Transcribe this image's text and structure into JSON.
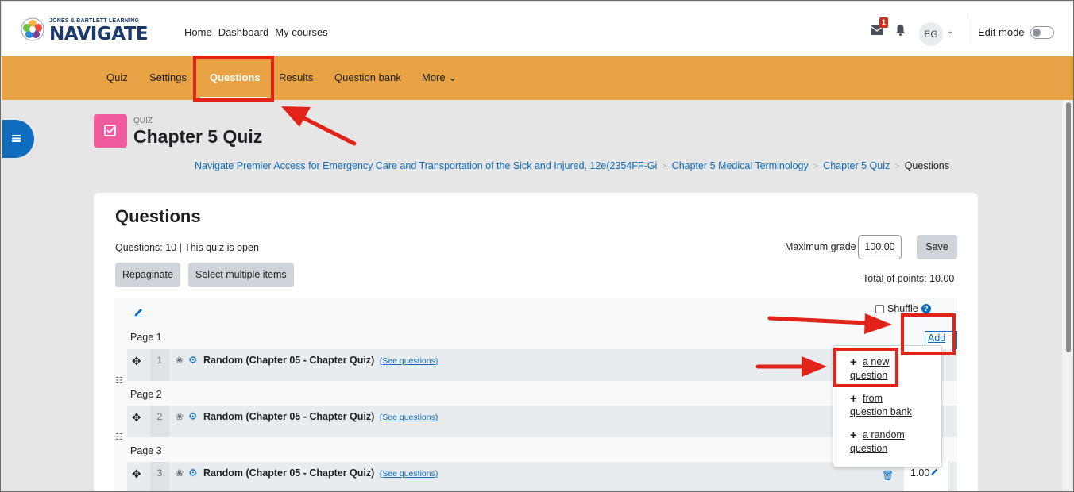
{
  "brand": {
    "sub": "JONES & BARTLETT LEARNING",
    "name": "NAVIGATE"
  },
  "topnav": [
    "Home",
    "Dashboard",
    "My courses"
  ],
  "notifications": {
    "message_count": "1",
    "user_initials": "EG",
    "edit_mode_label": "Edit mode"
  },
  "secnav": {
    "quiz": "Quiz",
    "settings": "Settings",
    "questions": "Questions",
    "results": "Results",
    "question_bank": "Question bank",
    "more": "More"
  },
  "header": {
    "type_label": "QUIZ",
    "title": "Chapter 5 Quiz",
    "breadcrumb": [
      "Navigate Premier Access for Emergency Care and Transportation of the Sick and Injured, 12e(2354FF-Gi",
      "Chapter 5 Medical Terminology",
      "Chapter 5 Quiz",
      "Questions"
    ]
  },
  "card": {
    "heading": "Questions",
    "status": "Questions: 10 | This quiz is open",
    "repaginate": "Repaginate",
    "select_multiple": "Select multiple items",
    "max_grade_label": "Maximum grade",
    "max_grade_value": "100.00",
    "save": "Save",
    "total_points": "Total of points: 10.00",
    "shuffle": "Shuffle",
    "add": "Add",
    "pages": [
      {
        "label": "Page 1",
        "num": "1",
        "text": "Random (Chapter 05 - Chapter Quiz)",
        "see": "(See questions)"
      },
      {
        "label": "Page 2",
        "num": "2",
        "text": "Random (Chapter 05 - Chapter Quiz)",
        "see": "(See questions)"
      },
      {
        "label": "Page 3",
        "num": "3",
        "text": "Random (Chapter 05 - Chapter Quiz)",
        "see": "(See questions)",
        "mark": "1.00"
      }
    ]
  },
  "add_menu": {
    "new_q": [
      "a new",
      "question"
    ],
    "from_bank": [
      "from",
      "question bank"
    ],
    "random_q": [
      "a random",
      "question"
    ]
  },
  "colors": {
    "secnav": "#e8a444",
    "link": "#0f6cbf",
    "annotation": "#e2231a",
    "quiz_icon": "#f05a9e"
  }
}
